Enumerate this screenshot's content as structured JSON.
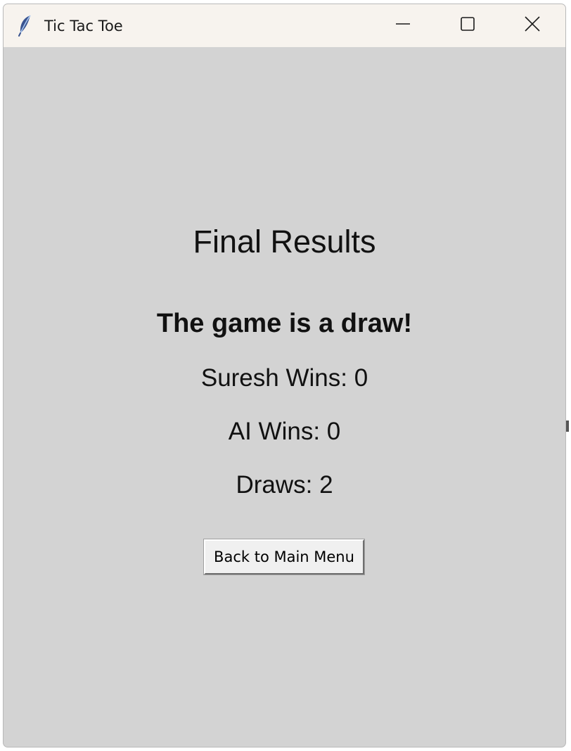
{
  "window": {
    "title": "Tic Tac Toe",
    "icon": "feather-icon"
  },
  "titlebar_controls": {
    "minimize_icon": "minimize-icon",
    "maximize_icon": "maximize-icon",
    "close_icon": "close-icon"
  },
  "results": {
    "heading": "Final Results",
    "message": "The game is a draw!",
    "stats": [
      "Suresh Wins: 0",
      "AI Wins: 0",
      "Draws: 2"
    ],
    "back_button_label": "Back to Main Menu"
  },
  "colors": {
    "window_background": "#d3d3d3",
    "titlebar_background": "#f7f3ee",
    "text": "#111111",
    "button_background": "#f0f0f0"
  }
}
